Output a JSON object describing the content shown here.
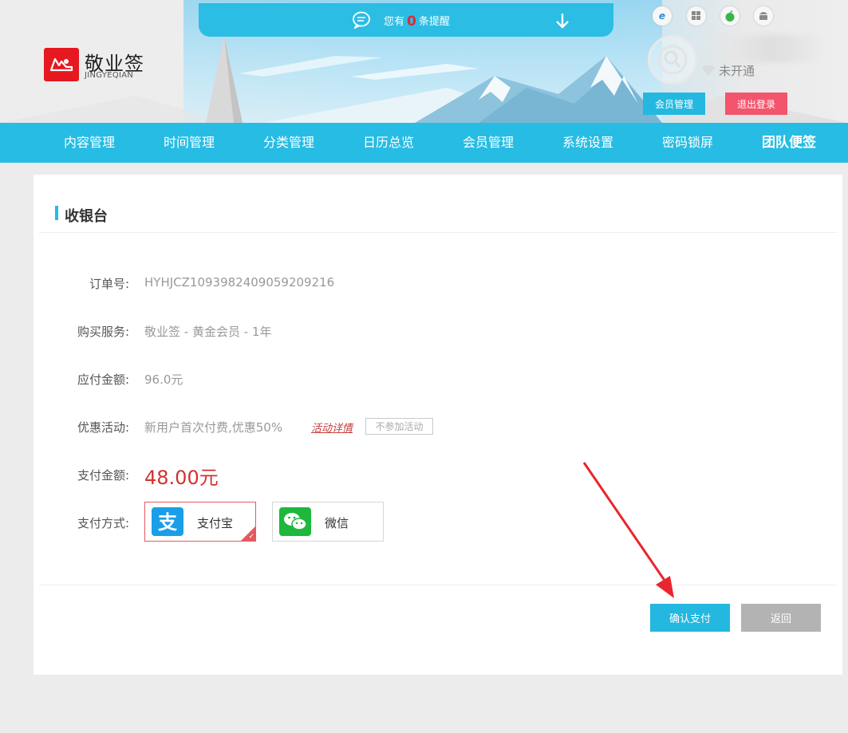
{
  "header": {
    "notice": {
      "prefix": "您有",
      "count": "0",
      "suffix": "条提醒"
    },
    "brand": {
      "name": "敬业签",
      "pinyin": "JINGYEQIAN"
    },
    "platforms": [
      "ie-icon",
      "windows-icon",
      "apple-icon",
      "android-icon"
    ],
    "user": {
      "vip_status": "未开通"
    },
    "buttons": {
      "member": "会员管理",
      "logout": "退出登录"
    }
  },
  "nav": {
    "items": [
      {
        "label": "内容管理"
      },
      {
        "label": "时间管理"
      },
      {
        "label": "分类管理"
      },
      {
        "label": "日历总览"
      },
      {
        "label": "会员管理"
      },
      {
        "label": "系统设置"
      },
      {
        "label": "密码锁屏"
      },
      {
        "label": "团队便签"
      }
    ]
  },
  "checkout": {
    "title": "收银台",
    "order_no": {
      "label": "订单号:",
      "value": "HYHJCZ1093982409059209216"
    },
    "service": {
      "label": "购买服务:",
      "value": "敬业签 - 黄金会员 - 1年"
    },
    "due": {
      "label": "应付金额:",
      "value": "96.0元"
    },
    "promo": {
      "label": "优惠活动:",
      "value": "新用户首次付费,优惠50%",
      "link": "活动详情",
      "opt_out": "不参加活动"
    },
    "pay_amount": {
      "label": "支付金额:",
      "value": "48.00元"
    },
    "pay_method": {
      "label": "支付方式:",
      "options": [
        {
          "label": "支付宝",
          "selected": true,
          "color": "#1a9ee8"
        },
        {
          "label": "微信",
          "selected": false,
          "color": "#1db83c"
        }
      ]
    },
    "buttons": {
      "confirm": "确认支付",
      "back": "返回"
    }
  },
  "colors": {
    "accent": "#27bce3",
    "danger": "#e5191f",
    "logout": "#f2556c",
    "price": "#d3312f",
    "annotation_arrow": "#e8262e"
  }
}
